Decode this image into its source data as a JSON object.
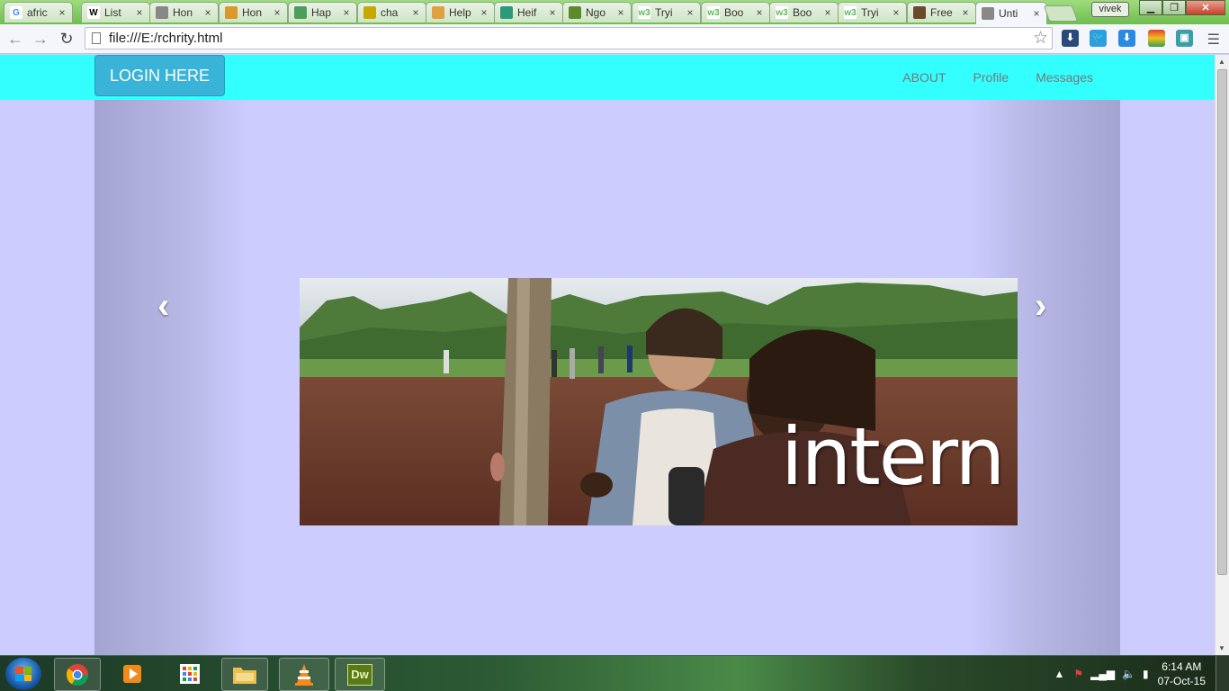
{
  "browser": {
    "tabs": [
      {
        "title": "afric",
        "icon": "google-icon",
        "color": "#4285f4",
        "glyph": "G"
      },
      {
        "title": "List",
        "icon": "wikipedia-icon",
        "color": "#000000",
        "glyph": "W"
      },
      {
        "title": "Hon",
        "icon": "page-icon",
        "color": "#888888",
        "glyph": ""
      },
      {
        "title": "Hon",
        "icon": "africa-icon",
        "color": "#d99a2b",
        "glyph": ""
      },
      {
        "title": "Hap",
        "icon": "hand-icon",
        "color": "#4aa05a",
        "glyph": ""
      },
      {
        "title": "cha",
        "icon": "charity-icon",
        "color": "#c8a800",
        "glyph": ""
      },
      {
        "title": "Help",
        "icon": "leaf-icon",
        "color": "#e0a040",
        "glyph": ""
      },
      {
        "title": "Heif",
        "icon": "heifer-icon",
        "color": "#2a9a7a",
        "glyph": ""
      },
      {
        "title": "Ngo",
        "icon": "ngo-icon",
        "color": "#5a8a2a",
        "glyph": ""
      },
      {
        "title": "Tryi",
        "icon": "w3schools-icon",
        "color": "#5cb85c",
        "glyph": "w3"
      },
      {
        "title": "Boo",
        "icon": "w3schools-icon",
        "color": "#5cb85c",
        "glyph": "w3"
      },
      {
        "title": "Boo",
        "icon": "w3schools-icon",
        "color": "#5cb85c",
        "glyph": "w3"
      },
      {
        "title": "Tryi",
        "icon": "w3schools-icon",
        "color": "#5cb85c",
        "glyph": "w3"
      },
      {
        "title": "Free",
        "icon": "template-icon",
        "color": "#6a4a2a",
        "glyph": ""
      },
      {
        "title": "Unti",
        "icon": "page-icon",
        "color": "#888888",
        "glyph": "",
        "active": true
      }
    ],
    "profile_name": "vivek",
    "url": "file:///E:/rchrity.html"
  },
  "page": {
    "login_button": "LOGIN HERE",
    "nav_links": [
      "ABOUT",
      "Profile",
      "Messages"
    ],
    "carousel": {
      "caption": "intern",
      "prev_glyph": "‹",
      "next_glyph": "›"
    }
  },
  "taskbar": {
    "apps": [
      "Google Chrome",
      "Media Player",
      "Apps Grid",
      "Windows Explorer",
      "VLC Media Player",
      "Dreamweaver"
    ],
    "dreamweaver_label": "Dw",
    "time": "6:14 AM",
    "date": "07-Oct-15"
  },
  "colors": {
    "navbar": "#33ffff",
    "page_background": "#ccccff",
    "login_button": "#39b3d7"
  }
}
